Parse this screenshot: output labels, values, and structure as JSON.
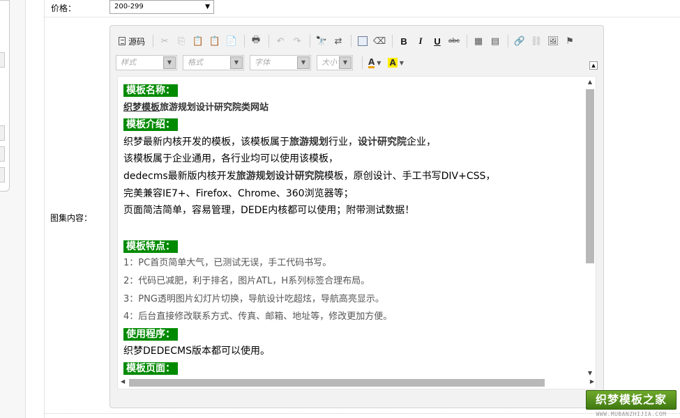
{
  "form": {
    "price_label": "价格：",
    "price_value": "200-299",
    "content_label": "图集内容："
  },
  "editor": {
    "toolbar": {
      "source_label": "源码",
      "style_placeholder": "样式",
      "format_placeholder": "格式",
      "font_placeholder": "字体",
      "size_placeholder": "大小",
      "bold": "B",
      "italic": "I",
      "underline": "U",
      "strike": "abc",
      "text_color": "A",
      "bg_color": "A"
    },
    "document": {
      "h_name": "模板名称：",
      "name_link": "织梦模板",
      "name_rest": "旅游规划设计研究院类网站",
      "h_intro": "模板介绍：",
      "intro1_a": "织梦最新内核开发的模板，该模板属于",
      "intro1_b": "旅游规划",
      "intro1_c": "行业，",
      "intro1_d": "设计研究院",
      "intro1_e": "企业，",
      "intro2": "该模板属于企业通用，各行业均可以使用该模板，",
      "intro3_a": "dedecms最新版内核开发",
      "intro3_b": "旅游规划设计研究院",
      "intro3_c": "模板，原创设计、手工书写DIV+CSS，",
      "intro4": "完美兼容IE7+、Firefox、Chrome、360浏览器等；",
      "intro5": "页面简洁简单，容易管理，DEDE内核都可以使用；附带测试数据！",
      "h_features": "模板特点：",
      "feat1": "1：PC首页简单大气，已测试无误，手工代码书写。",
      "feat2": "2：代码已减肥，利于排名，图片ATL，H系列标签合理布局。",
      "feat3": "3：PNG透明图片幻灯片切换，导航设计吃超炫，导航高亮显示。",
      "feat4": "4：后台直接修改联系方式、传真、邮箱、地址等，修改更加方便。",
      "h_program": "使用程序：",
      "program": "织梦DEDECMS版本都可以使用。",
      "h_pages": "模板页面："
    }
  },
  "watermark": {
    "brand": "织梦模板之家",
    "url": "WWW.MUBANZHIJIA.COM"
  },
  "colors": {
    "heading_bg": "#008a00",
    "brand_green": "#4f8f1a"
  }
}
